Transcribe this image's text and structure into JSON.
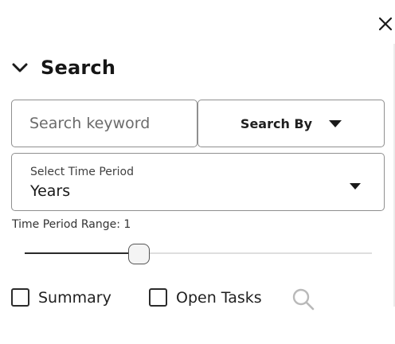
{
  "header": {
    "close_icon": "close-icon"
  },
  "search_section": {
    "title": "Search",
    "expanded": true,
    "toggle_icon": "chevron-down-icon"
  },
  "keyword": {
    "placeholder": "Search keyword",
    "value": ""
  },
  "search_by": {
    "label": "Search By",
    "icon": "caret-down-icon"
  },
  "time_period": {
    "label": "Select Time Period",
    "value": "Years",
    "icon": "caret-down-icon"
  },
  "range": {
    "label": "Time Period Range: 1",
    "value": 1,
    "slider_fraction": 0.33
  },
  "filters": [
    {
      "label": "Summary",
      "checked": false
    },
    {
      "label": "Open Tasks",
      "checked": false
    }
  ],
  "actions": {
    "search_icon": "search-icon"
  },
  "colors": {
    "border": "#8f8f8f",
    "text": "#1a1a1a",
    "muted_icon": "#b9b9b9",
    "track": "#dedede",
    "track_fill": "#2a2a2a"
  }
}
